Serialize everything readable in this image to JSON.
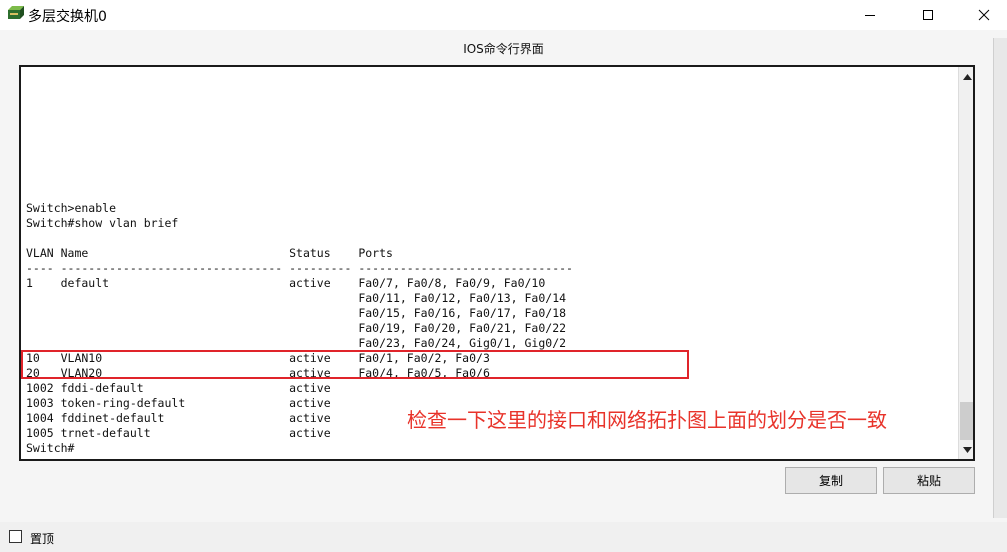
{
  "window": {
    "title": "多层交换机0",
    "caption": "IOS命令行界面",
    "controls": [
      "minimize-icon",
      "maximize-icon",
      "close-icon"
    ]
  },
  "terminal": {
    "lines": [
      "Switch>enable",
      "Switch#show vlan brief",
      "",
      "VLAN Name                             Status    Ports",
      "---- -------------------------------- --------- -------------------------------",
      "1    default                          active    Fa0/7, Fa0/8, Fa0/9, Fa0/10",
      "                                                Fa0/11, Fa0/12, Fa0/13, Fa0/14",
      "                                                Fa0/15, Fa0/16, Fa0/17, Fa0/18",
      "                                                Fa0/19, Fa0/20, Fa0/21, Fa0/22",
      "                                                Fa0/23, Fa0/24, Gig0/1, Gig0/2",
      "10   VLAN10                           active    Fa0/1, Fa0/2, Fa0/3",
      "20   VLAN20                           active    Fa0/4, Fa0/5, Fa0/6",
      "1002 fddi-default                     active",
      "1003 token-ring-default               active",
      "1004 fddinet-default                  active",
      "1005 trnet-default                    active",
      "Switch#"
    ]
  },
  "annotation": "检查一下这里的接口和网络拓扑图上面的划分是否一致",
  "buttons": {
    "copy": "复制",
    "paste": "粘贴"
  },
  "footer": {
    "always_on_top_label": "置顶",
    "always_on_top_checked": false
  },
  "colors": {
    "annotation": "#e8332a",
    "highlight_box": "#e0242a"
  }
}
